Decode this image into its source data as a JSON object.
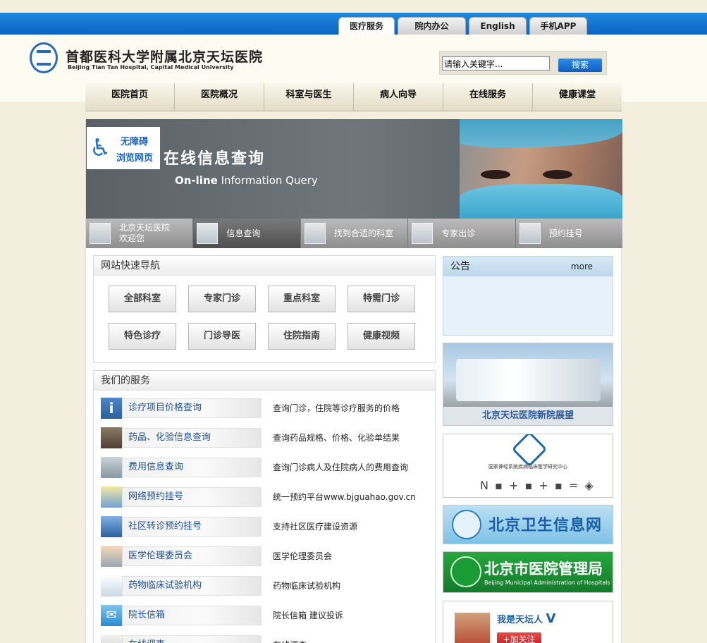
{
  "top_tabs": [
    "医疗服务",
    "院内办公",
    "English",
    "手机APP"
  ],
  "header": {
    "hospital_name": "首都医科大学附属北京天坛医院",
    "hospital_name_en": "Beijing Tian Tan Hospital, Capital Medical University",
    "search_placeholder": "请输入关键字...",
    "search_button": "搜索"
  },
  "main_nav": [
    "医院首页",
    "医院概况",
    "科室与医生",
    "病人向导",
    "在线服务",
    "健康课堂"
  ],
  "banner": {
    "title": "在线信息查询",
    "subtitle_bold": "On-line",
    "subtitle_rest": " Information Query",
    "accessibility_line1": "无障碍",
    "accessibility_line2": "浏览网页"
  },
  "sub_tabs": [
    {
      "label_line1": "北京天坛医院",
      "label_line2": "欢迎您"
    },
    {
      "label_line1": "信息查询",
      "label_line2": ""
    },
    {
      "label_line1": "找到合适的科室",
      "label_line2": ""
    },
    {
      "label_line1": "专家出诊",
      "label_line2": ""
    },
    {
      "label_line1": "预约挂号",
      "label_line2": ""
    }
  ],
  "quick_nav": {
    "title": "网站快速导航",
    "buttons": [
      "全部科室",
      "专家门诊",
      "重点科室",
      "特需门诊",
      "特色诊疗",
      "门诊导医",
      "住院指南",
      "健康视频"
    ]
  },
  "services": {
    "title": "我们的服务",
    "items": [
      {
        "label": "诊疗项目价格查询",
        "desc": "查询门诊，住院等诊疗服务的价格"
      },
      {
        "label": "药品、化验信息查询",
        "desc": "查询药品规格、价格、化验单结果"
      },
      {
        "label": "费用信息查询",
        "desc": "查询门诊病人及住院病人的费用查询"
      },
      {
        "label": "网络预约挂号",
        "desc": "统一预约平台www.bjguahao.gov.cn"
      },
      {
        "label": "社区转诊预约挂号",
        "desc": "支持社区医疗建设资源"
      },
      {
        "label": "医学伦理委员会",
        "desc": "医学伦理委员会"
      },
      {
        "label": "药物临床试验机构",
        "desc": "药物临床试验机构"
      },
      {
        "label": "院长信箱",
        "desc": "院长信箱  建议投诉"
      },
      {
        "label": "在线调查",
        "desc": "在线调查"
      }
    ]
  },
  "notice": {
    "title": "公告",
    "more": "more"
  },
  "sidebar": {
    "new_hospital": "北京天坛医院新院展望",
    "research_center": "国家神经系统疾病临床医学研究中心",
    "health_info": "北京卫生信息网",
    "admin_cn": "北京市医院管理局",
    "admin_en": "Beijing Municipal Administration of Hospitals",
    "weibo_name": "我是天坛人",
    "weibo_v": "V",
    "weibo_follow": "+加关注"
  }
}
